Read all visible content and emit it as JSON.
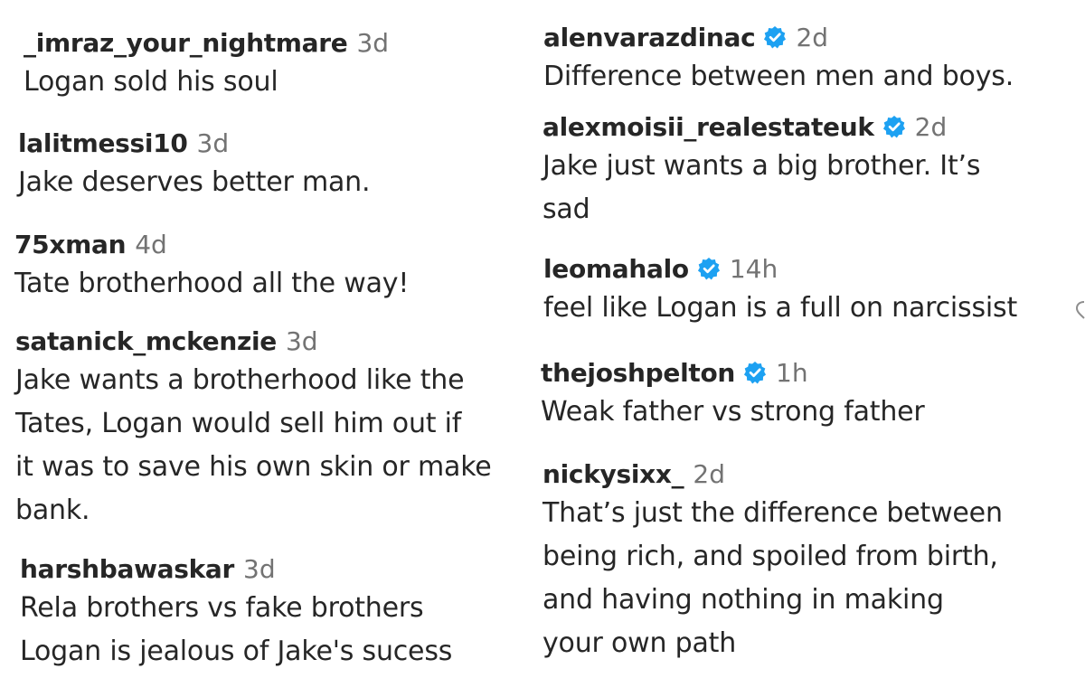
{
  "verified_color": "#1da1f2",
  "left_column": [
    {
      "username": "_imraz_your_nightmare",
      "time": "3d",
      "lines": [
        "Logan sold his soul"
      ],
      "verified": false
    },
    {
      "username": "lalitmessi10",
      "time": "3d",
      "lines": [
        "Jake deserves better man."
      ],
      "verified": false
    },
    {
      "username": "75xman",
      "time": "4d",
      "lines": [
        "Tate brotherhood all the way!"
      ],
      "verified": false
    },
    {
      "username": "satanick_mckenzie",
      "time": "3d",
      "lines": [
        "Jake wants a brotherhood like the",
        "Tates, Logan would sell him out if",
        "it was to save his own skin or make",
        "bank."
      ],
      "verified": false
    },
    {
      "username": "harshbawaskar",
      "time": "3d",
      "lines": [
        "Rela brothers vs fake brothers",
        "Logan is jealous of Jake's sucess"
      ],
      "verified": false
    }
  ],
  "right_column": [
    {
      "username": "alenvarazdinac",
      "time": "2d",
      "lines": [
        "Difference between men and boys."
      ],
      "verified": true
    },
    {
      "username": "alexmoisii_realestateuk",
      "time": "2d",
      "lines": [
        "Jake just wants a big brother. It’s",
        "sad"
      ],
      "verified": true
    },
    {
      "username": "leomahalo",
      "time": "14h",
      "lines": [
        "feel like Logan is a full on narcissist"
      ],
      "verified": true
    },
    {
      "username": "thejoshpelton",
      "time": "1h",
      "lines": [
        "Weak father vs strong father"
      ],
      "verified": true
    },
    {
      "username": "nickysixx_",
      "time": "2d",
      "lines": [
        "That’s just the difference between",
        "being rich, and spoiled from birth,",
        "and having nothing in making",
        "your own path"
      ],
      "verified": false
    }
  ]
}
